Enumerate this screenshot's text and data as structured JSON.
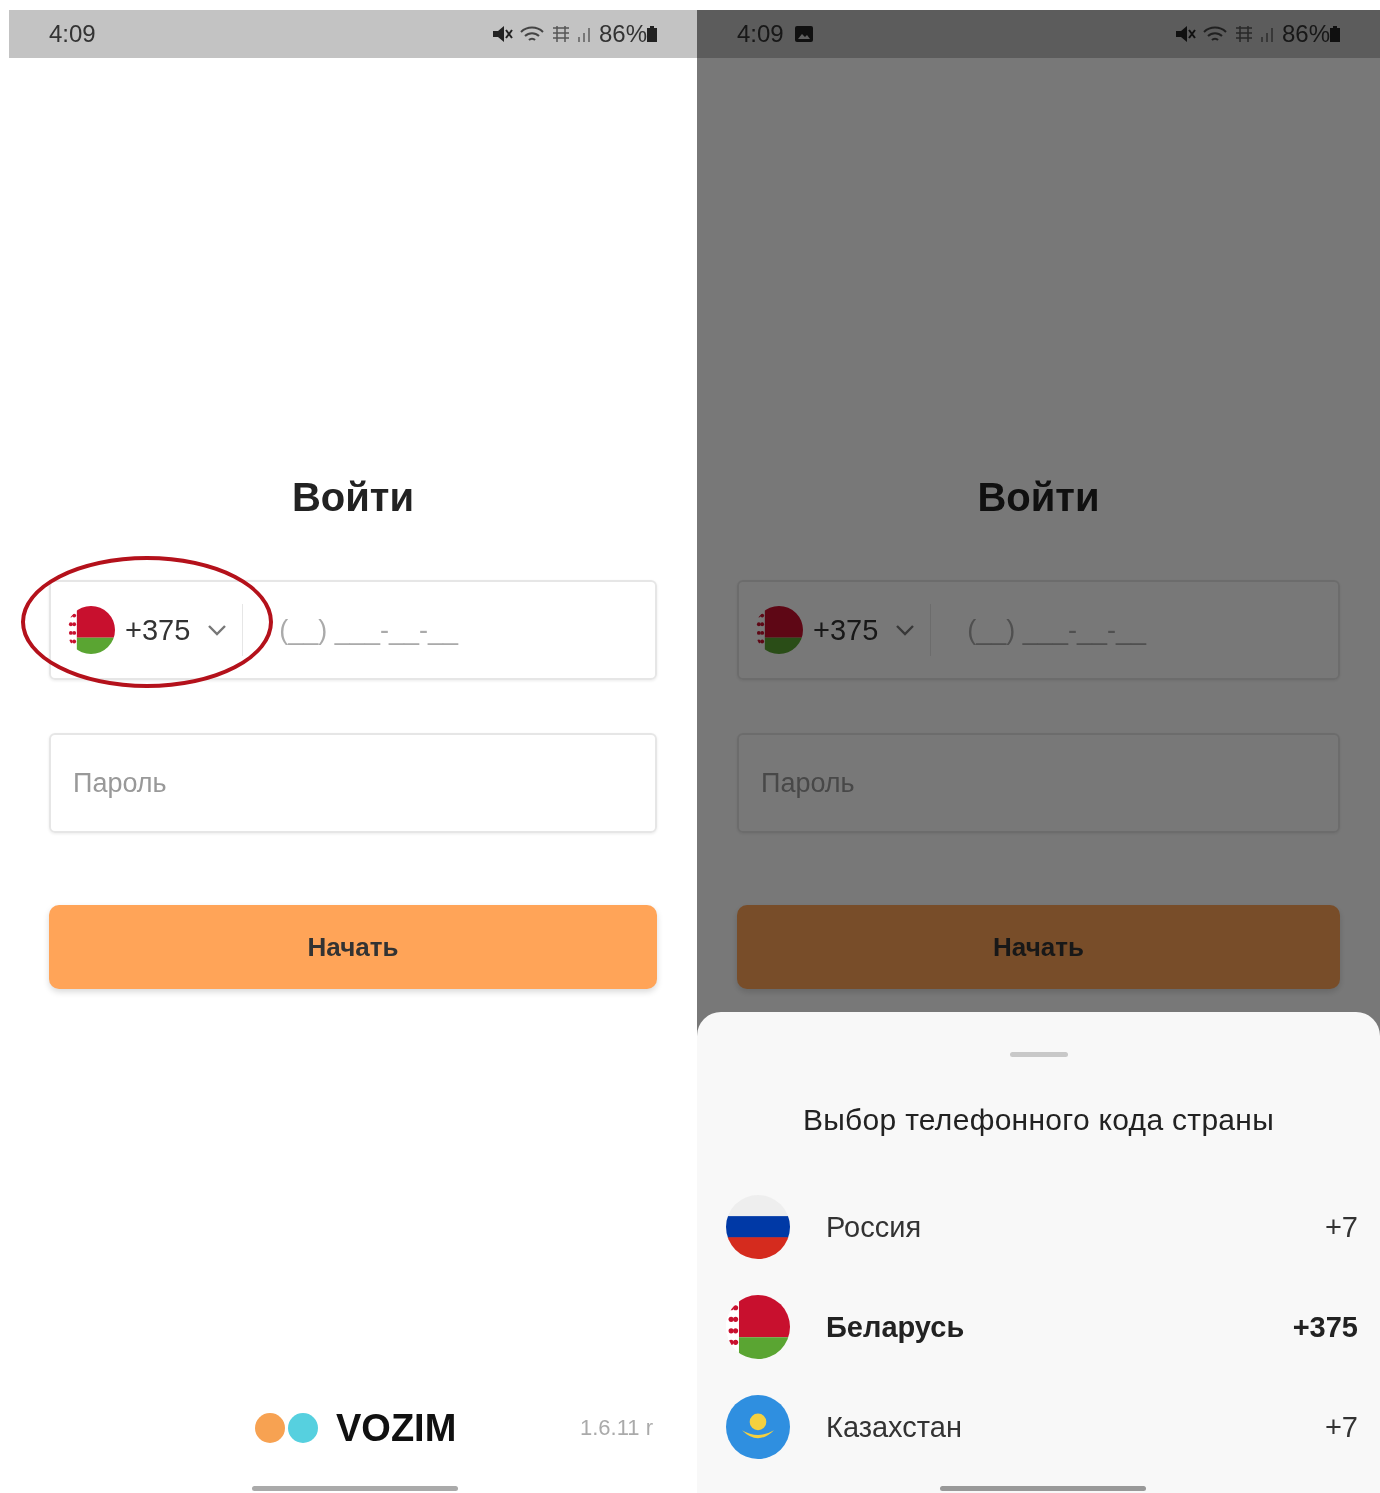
{
  "screens": [
    {
      "dimmed": false,
      "status_bar": {
        "time": "4:09",
        "notification_icon": false,
        "battery": "86%"
      },
      "title": "Войти",
      "phone_field": {
        "country_code": "+375",
        "placeholder": "(__) ___-__-__"
      },
      "password_field": {
        "placeholder": "Пароль"
      },
      "start_button": "Начать",
      "annotation_circle": true,
      "brand": "VOZIM",
      "version": "1.6.11 r"
    },
    {
      "dimmed": true,
      "status_bar": {
        "time": "4:09",
        "notification_icon": true,
        "battery": "86%"
      },
      "title": "Войти",
      "phone_field": {
        "country_code": "+375",
        "placeholder": "(__) ___-__-__"
      },
      "password_field": {
        "placeholder": "Пароль"
      },
      "start_button": "Начать",
      "annotation_circle": false,
      "sheet": {
        "title": "Выбор телефонного кода страны",
        "countries": [
          {
            "kind": "ru",
            "name": "Россия",
            "code": "+7",
            "selected": false
          },
          {
            "kind": "by",
            "name": "Беларусь",
            "code": "+375",
            "selected": true
          },
          {
            "kind": "kz",
            "name": "Казахстан",
            "code": "+7",
            "selected": false
          }
        ]
      }
    }
  ]
}
